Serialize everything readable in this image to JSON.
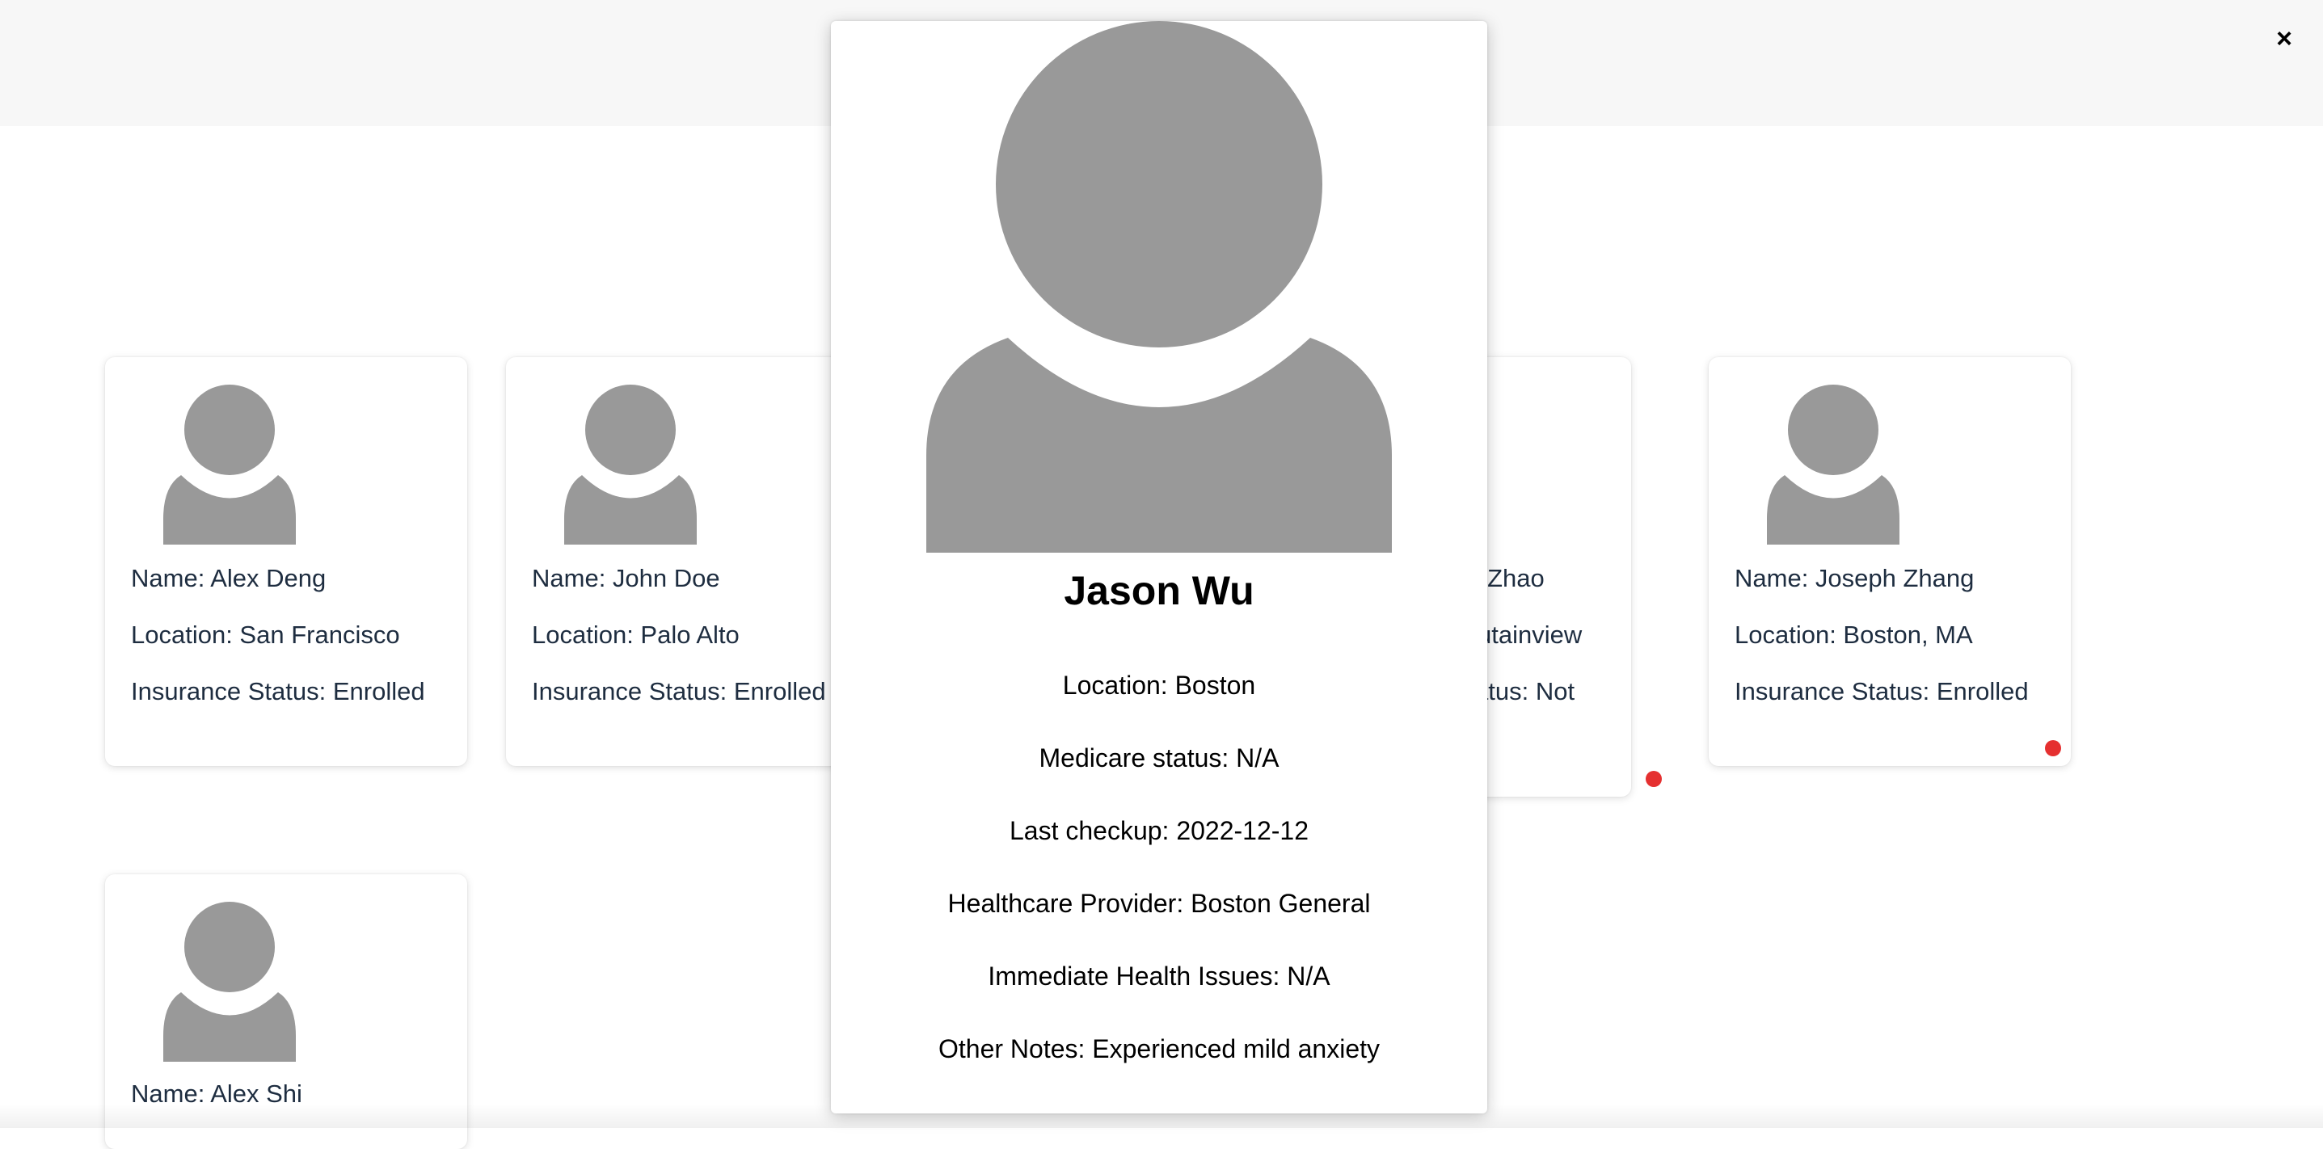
{
  "modal": {
    "close_icon": "×",
    "name": "Jason Wu",
    "details": [
      "Location: Boston",
      "Medicare status: N/A",
      "Last checkup: 2022-12-12",
      "Healthcare Provider: Boston General",
      "Immediate Health Issues: N/A",
      "Other Notes: Experienced mild anxiety"
    ]
  },
  "cards": [
    {
      "name": "Name: Alex Deng",
      "location": "Location: San Francisco",
      "insurance": "Insurance Status: Enrolled",
      "alert": false
    },
    {
      "name": "Name: John Doe",
      "location": "Location: Palo Alto",
      "insurance": "Insurance Status: Enrolled",
      "alert": false
    },
    {
      "name": "y Zhao",
      "location": "utainview",
      "insurance": "atus: Not",
      "alert": true
    },
    {
      "name": "Name: Joseph Zhang",
      "location": "Location: Boston, MA",
      "insurance": "Insurance Status: Enrolled",
      "alert": true
    },
    {
      "name": "Name: Alex Shi",
      "alert": false
    }
  ],
  "colors": {
    "avatar_gray": "#999999",
    "alert_dot": "#e53030",
    "card_text": "#1e2d40",
    "topbar_bg": "#f7f7f7"
  },
  "icons": {
    "avatar": "person-silhouette-icon",
    "close": "close-icon"
  }
}
